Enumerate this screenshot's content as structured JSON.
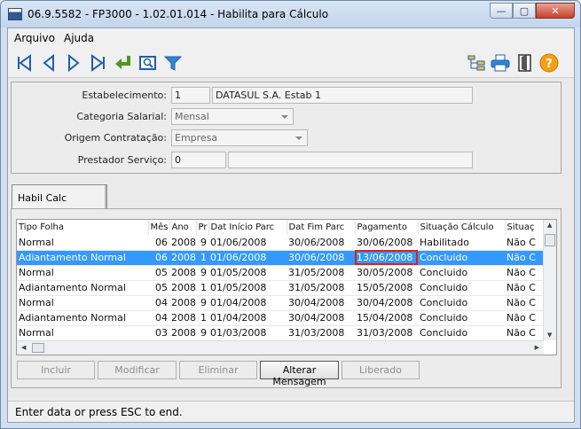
{
  "window": {
    "title": "06.9.5582 - FP3000 - 1.02.01.014 - Habilita para Cálculo"
  },
  "menu": {
    "items": [
      "Arquivo",
      "Ajuda"
    ]
  },
  "toolbar": {
    "icons": [
      "first-icon",
      "previous-icon",
      "next-icon",
      "last-icon",
      "goto-icon",
      "search-icon",
      "filter-icon",
      "tree-icon",
      "print-icon",
      "exit-icon",
      "help-icon"
    ],
    "accent": "#1f5fa8"
  },
  "form": {
    "estabelecimento": {
      "label": "Estabelecimento:",
      "code": "1",
      "name": "DATASUL S.A. Estab 1"
    },
    "categoria": {
      "label": "Categoria Salarial:",
      "value": "Mensal"
    },
    "origem": {
      "label": "Origem Contratação:",
      "value": "Empresa"
    },
    "prestador": {
      "label": "Prestador Serviço:",
      "code": "0",
      "name": ""
    }
  },
  "tab": {
    "label": "Habil Calc"
  },
  "grid": {
    "columns": [
      "Tipo Folha",
      "Mês",
      "Ano",
      "Pr",
      "Dat Início Parc",
      "Dat Fim Parc",
      "Pagamento",
      "Situação Cálculo",
      "Situaç"
    ],
    "rows": [
      [
        "Normal",
        "06",
        "2008",
        "9",
        "01/06/2008",
        "30/06/2008",
        "30/06/2008",
        "Habilitado",
        "Não C"
      ],
      [
        "Adiantamento Normal",
        "06",
        "2008",
        "1",
        "01/06/2008",
        "30/06/2008",
        "13/06/2008",
        "Concluido",
        "Não C"
      ],
      [
        "Normal",
        "05",
        "2008",
        "9",
        "01/05/2008",
        "31/05/2008",
        "30/05/2008",
        "Concluido",
        "Não C"
      ],
      [
        "Adiantamento Normal",
        "05",
        "2008",
        "1",
        "01/05/2008",
        "31/05/2008",
        "15/05/2008",
        "Concluido",
        "Não C"
      ],
      [
        "Normal",
        "04",
        "2008",
        "9",
        "01/04/2008",
        "30/04/2008",
        "30/04/2008",
        "Concluido",
        "Não C"
      ],
      [
        "Adiantamento Normal",
        "04",
        "2008",
        "1",
        "01/04/2008",
        "30/04/2008",
        "15/04/2008",
        "Concluido",
        "Não C"
      ],
      [
        "Normal",
        "03",
        "2008",
        "9",
        "01/03/2008",
        "31/03/2008",
        "31/03/2008",
        "Concluido",
        "Não C"
      ]
    ],
    "selected_row": 1,
    "selection_color": "#3399ff",
    "highlight_color": "#e0201c"
  },
  "buttons": {
    "incluir": "Incluir",
    "modificar": "Modificar",
    "eliminar": "Eliminar",
    "alterar": "Alterar Mensagem",
    "liberado": "Liberado"
  },
  "status": {
    "text": "Enter data or press ESC to end."
  }
}
